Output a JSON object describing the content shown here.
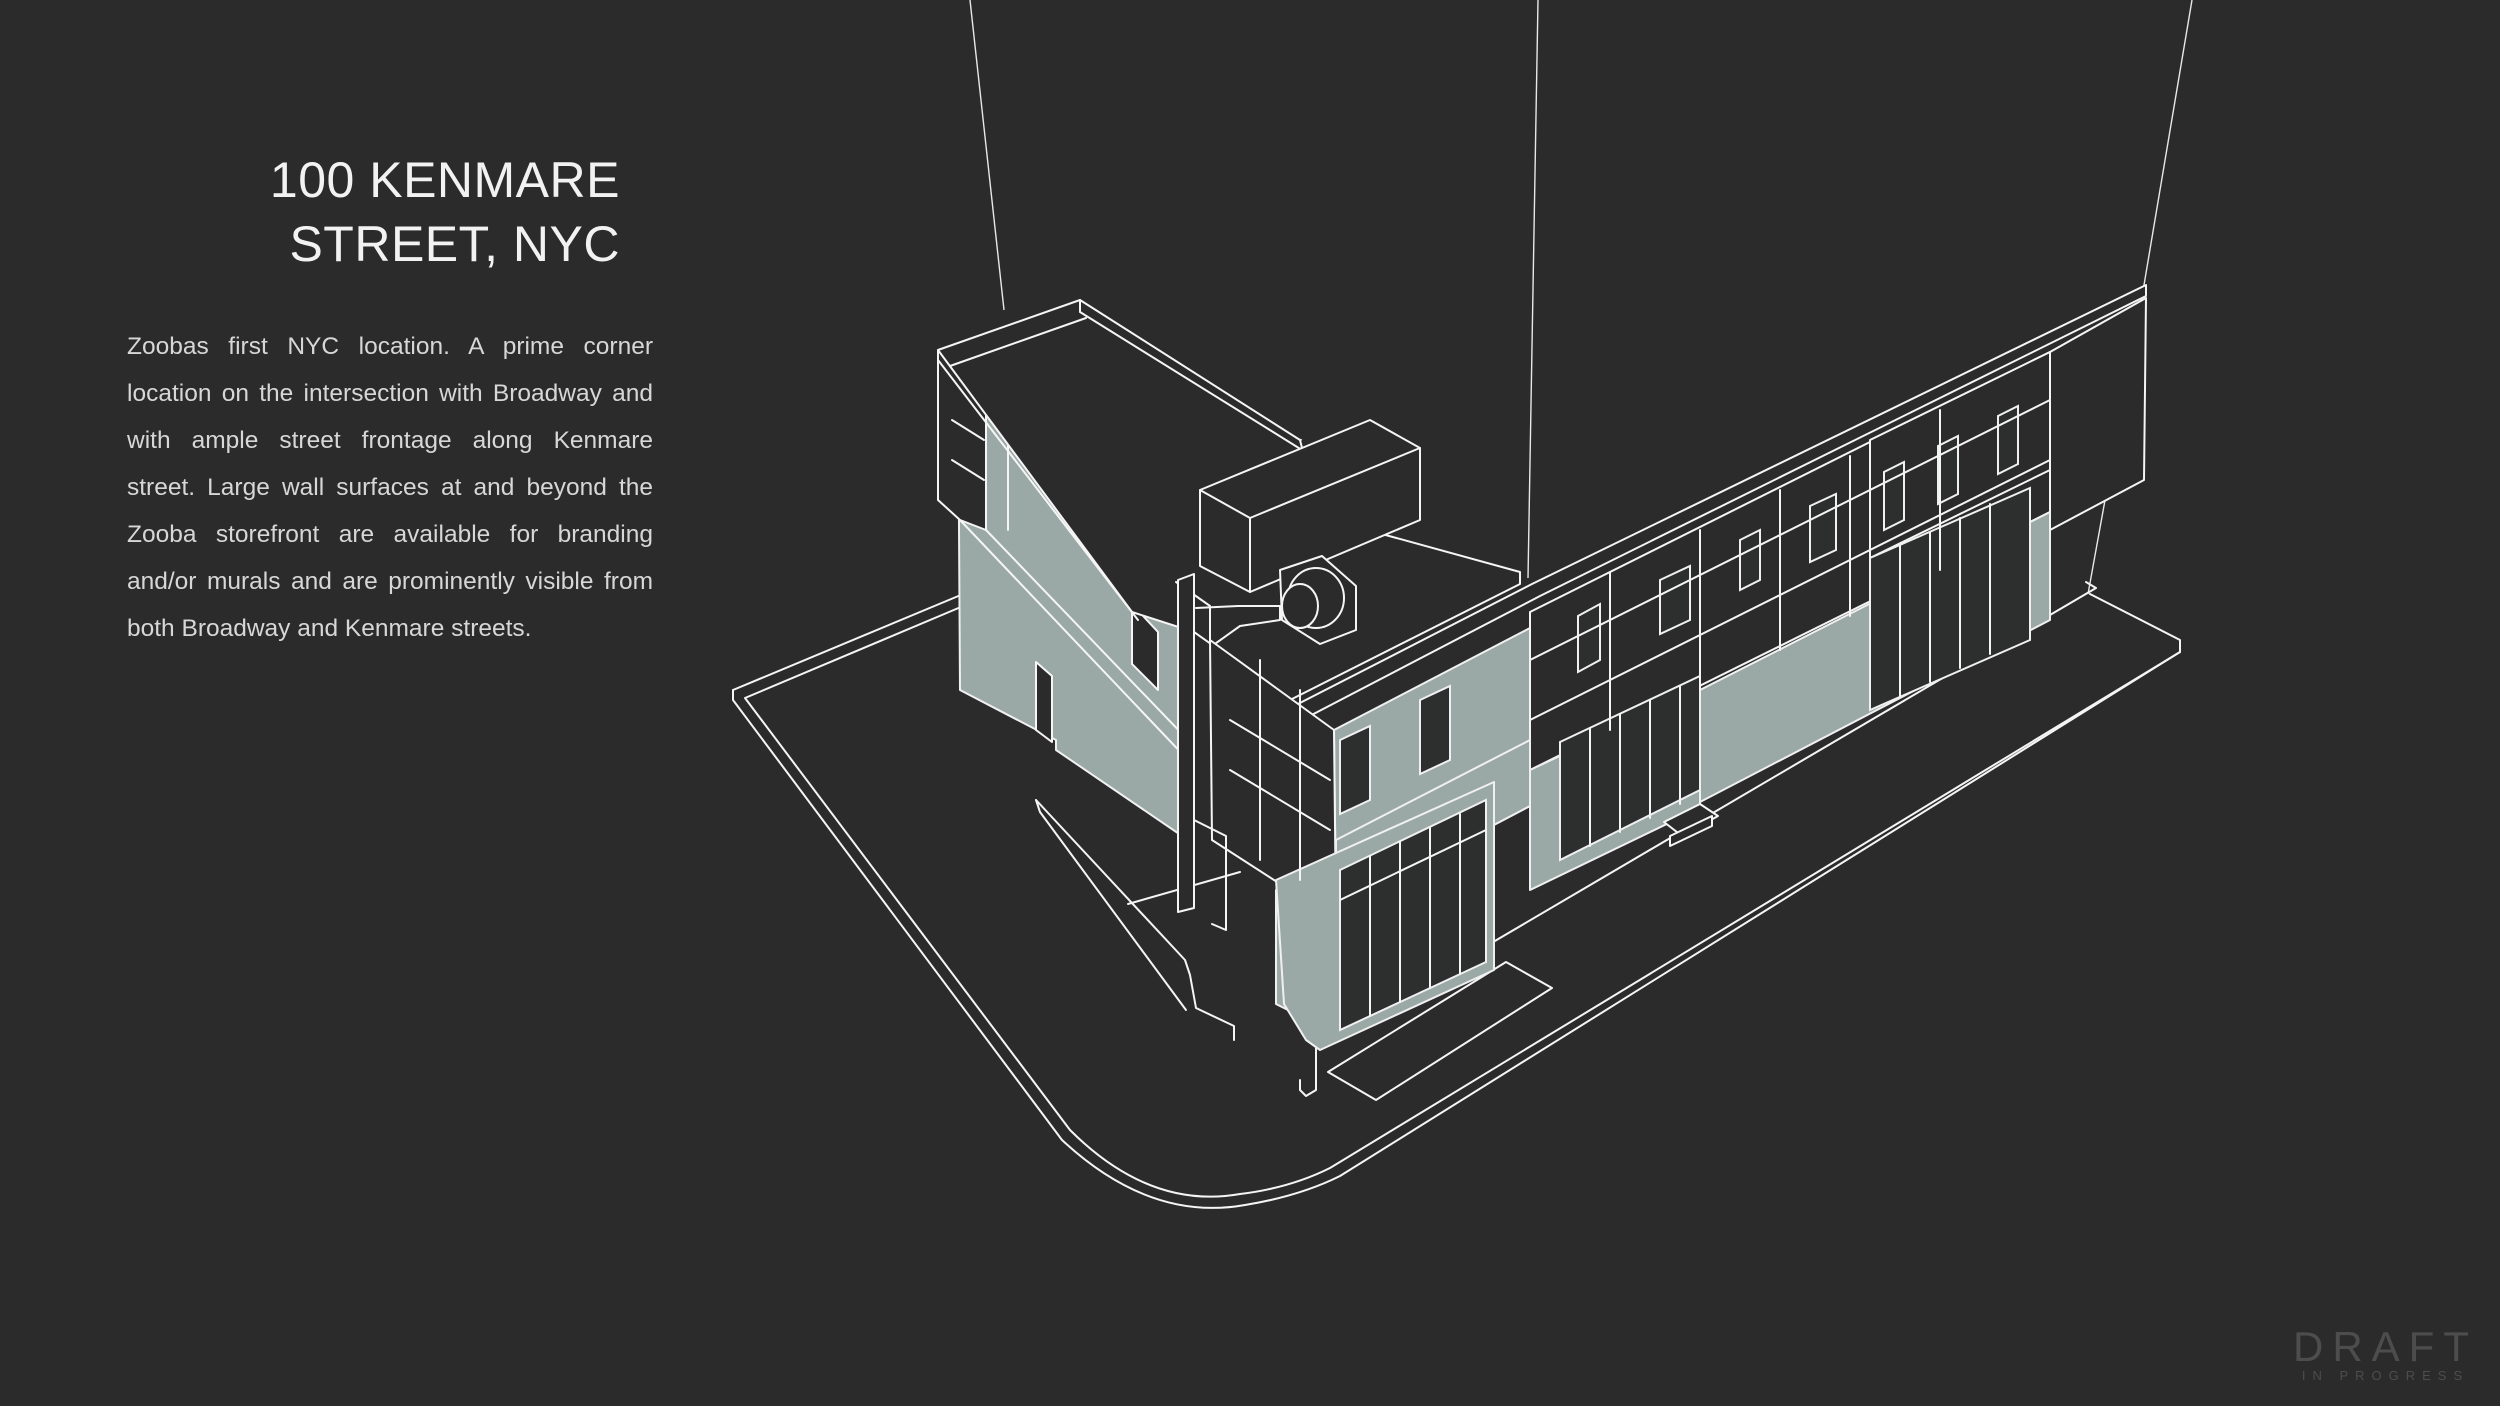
{
  "title": {
    "line1": "100 KENMARE",
    "line2": "STREET, NYC"
  },
  "description": "Zoobas first NYC location. A prime corner location on the intersection with Broadway and with ample street frontage along Kenmare street. Large wall surfaces at and beyond the Zooba storefront are available for branding and/or murals and are prominently visible from both Broadway and Kenmare streets.",
  "watermark": {
    "main": "DRAFT",
    "sub": "IN PROGRESS"
  },
  "colors": {
    "background": "#2b2b2b",
    "wall": "#9aa8a6",
    "line": "#f5f5f5"
  }
}
